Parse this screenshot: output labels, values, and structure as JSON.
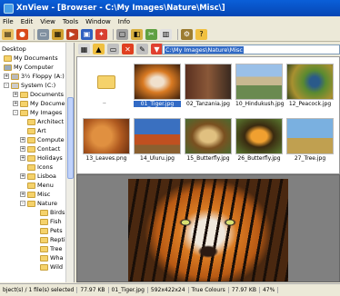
{
  "window": {
    "title": "XnView - [Browser - C:\\My Images\\Nature\\Misc\\]"
  },
  "menu": [
    "File",
    "Edit",
    "View",
    "Tools",
    "Window",
    "Info"
  ],
  "tree": [
    {
      "label": "Desktop"
    },
    {
      "label": "My Documents"
    },
    {
      "label": "My Computer"
    },
    {
      "label": "3½ Floppy (A:)"
    },
    {
      "label": "System (C:)"
    },
    {
      "label": "Documents a"
    },
    {
      "label": "My Documen"
    },
    {
      "label": "My Images"
    },
    {
      "label": "Architect"
    },
    {
      "label": "Art"
    },
    {
      "label": "Compute"
    },
    {
      "label": "Contact"
    },
    {
      "label": "Holidays"
    },
    {
      "label": "Icons"
    },
    {
      "label": "Lisboa"
    },
    {
      "label": "Menu"
    },
    {
      "label": "Misc"
    },
    {
      "label": "Nature"
    },
    {
      "label": "Birds"
    },
    {
      "label": "Fish"
    },
    {
      "label": "Pets"
    },
    {
      "label": "Repti"
    },
    {
      "label": "Tree"
    },
    {
      "label": "Wha"
    },
    {
      "label": "Wild"
    }
  ],
  "address": {
    "value": "C:\\My Images\\Nature\\Misc"
  },
  "thumbs": [
    {
      "label": ""
    },
    {
      "label": "01_Tiger.jpg"
    },
    {
      "label": "02_Tanzania.jpg"
    },
    {
      "label": "10_Hindukush.jpg"
    },
    {
      "label": "12_Peacock.jpg"
    },
    {
      "label": "13_Leaves.png"
    },
    {
      "label": "14_Uluru.jpg"
    },
    {
      "label": "15_Butterfly.jpg"
    },
    {
      "label": "26_Butterfly.jpg"
    },
    {
      "label": "27_Tree.jpg"
    }
  ],
  "folder_up": {
    "label": ".."
  },
  "status": {
    "objects": "bject(s) / 1 file(s) selected",
    "size": "77.97 KB",
    "file": "01_Tiger.jpg",
    "dims": "592x422x24",
    "colors": "True Colours",
    "filesize": "77.97 KB",
    "zoom": "47%"
  },
  "colors": {
    "title": "#0a5fd8",
    "selection": "#316ac5"
  }
}
